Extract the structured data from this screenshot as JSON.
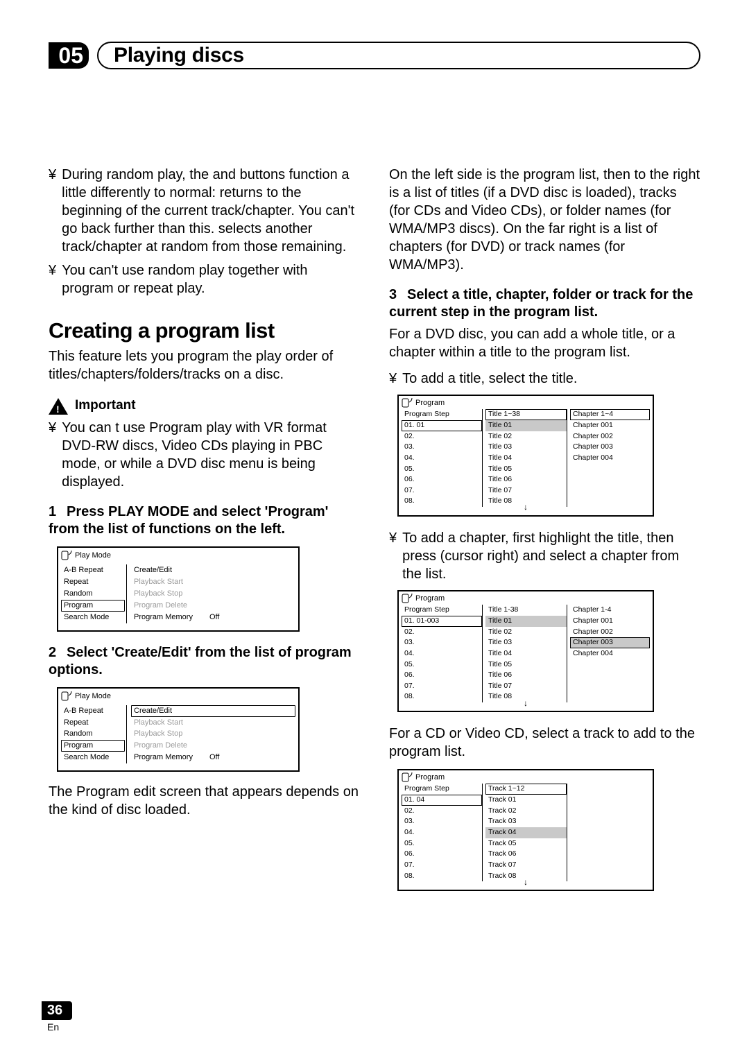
{
  "chapter": {
    "number": "05",
    "title": "Playing discs"
  },
  "left": {
    "bullet1_marker": "¥",
    "bullet1": "During random play, the        and        buttons function a little differently to normal:        returns to the beginning of the current track/chapter. You can't go back further than this.        selects another track/chapter at random from those remaining.",
    "bullet2_marker": "¥",
    "bullet2": "You can't use random play together with program or repeat play.",
    "h2": "Creating a program list",
    "intro": "This feature lets you program the play order of titles/chapters/folders/tracks on a disc.",
    "important_label": "Important",
    "bullet3_marker": "¥",
    "bullet3": "You can t use Program play with VR format DVD-RW discs, Video CDs playing in PBC mode, or while a DVD disc menu is being displayed.",
    "step1": "Press PLAY MODE and select 'Program' from the list of functions on the left.",
    "osd1": {
      "title": "Play Mode",
      "left_items": [
        "A-B Repeat",
        "Repeat",
        "Random",
        "Program",
        "Search Mode"
      ],
      "left_selected_index": 3,
      "right_items": [
        {
          "label": "Create/Edit",
          "state": "normal"
        },
        {
          "label": "Playback Start",
          "state": "disabled"
        },
        {
          "label": "Playback Stop",
          "state": "disabled"
        },
        {
          "label": "Program Delete",
          "state": "disabled"
        },
        {
          "label": "Program Memory",
          "state": "normal",
          "suffix": "Off"
        }
      ]
    },
    "step2": "Select 'Create/Edit' from the list of program options.",
    "osd2": {
      "title": "Play Mode",
      "left_items": [
        "A-B Repeat",
        "Repeat",
        "Random",
        "Program",
        "Search Mode"
      ],
      "left_selected_index": 3,
      "right_items": [
        {
          "label": "Create/Edit",
          "state": "selected"
        },
        {
          "label": "Playback Start",
          "state": "disabled"
        },
        {
          "label": "Playback Stop",
          "state": "disabled"
        },
        {
          "label": "Program Delete",
          "state": "disabled"
        },
        {
          "label": "Program Memory",
          "state": "normal",
          "suffix": "Off"
        }
      ]
    },
    "after_osd2": "The Program edit screen that appears depends on the kind of disc loaded."
  },
  "right": {
    "para1": "On the left side is the program list, then to the right is a list of titles (if a DVD disc is loaded), tracks (for CDs and Video CDs), or folder names (for WMA/MP3 discs). On the far right is a list of chapters (for DVD) or track names (for WMA/MP3).",
    "step3": "Select a title, chapter, folder or track for the current step in the program list.",
    "para2": "For a DVD disc, you can add a whole title, or a chapter within a title to the program list.",
    "bulletA_marker": "¥",
    "bulletA": "To add a title, select the title.",
    "osd3": {
      "title": "Program",
      "step_header": "Program Step",
      "title_header": "Title 1~38",
      "chap_header": "Chapter 1~4",
      "steps": [
        "01. 01",
        "02.",
        "03.",
        "04.",
        "05.",
        "06.",
        "07.",
        "08."
      ],
      "step_boxed_index": 0,
      "titles": [
        "Title 01",
        "Title 02",
        "Title 03",
        "Title 04",
        "Title 05",
        "Title 06",
        "Title 07",
        "Title 08"
      ],
      "title_hl_index": 0,
      "title_header_boxed": true,
      "chapters": [
        "Chapter 001",
        "Chapter 002",
        "Chapter 003",
        "Chapter 004"
      ],
      "chap_header_boxed": true
    },
    "bulletB_marker": "¥",
    "bulletB": "To add a chapter, first highlight the title, then press      (cursor right) and select a chapter from the list.",
    "osd4": {
      "title": "Program",
      "step_header": "Program Step",
      "title_header": "Title 1-38",
      "chap_header": "Chapter 1-4",
      "steps": [
        "01. 01-003",
        "02.",
        "03.",
        "04.",
        "05.",
        "06.",
        "07.",
        "08."
      ],
      "step_boxed_index": 0,
      "titles": [
        "Title 01",
        "Title 02",
        "Title 03",
        "Title 04",
        "Title 05",
        "Title 06",
        "Title 07",
        "Title 08"
      ],
      "title_hl_index": 0,
      "chapters": [
        "Chapter 001",
        "Chapter 002",
        "Chapter 003",
        "Chapter 004"
      ],
      "chap_boxed_index": 2,
      "chap_hl_index": 2
    },
    "para3": "For a CD or Video CD, select a track to add to the program list.",
    "osd5": {
      "title": "Program",
      "step_header": "Program Step",
      "title_header": "Track 1~12",
      "steps": [
        "01. 04",
        "02.",
        "03.",
        "04.",
        "05.",
        "06.",
        "07.",
        "08."
      ],
      "step_boxed_index": 0,
      "titles": [
        "Track 01",
        "Track 02",
        "Track 03",
        "Track 04",
        "Track 05",
        "Track 06",
        "Track 07",
        "Track 08"
      ],
      "title_hl_index": 3,
      "title_header_boxed": true
    }
  },
  "footer": {
    "page": "36",
    "lang": "En"
  }
}
